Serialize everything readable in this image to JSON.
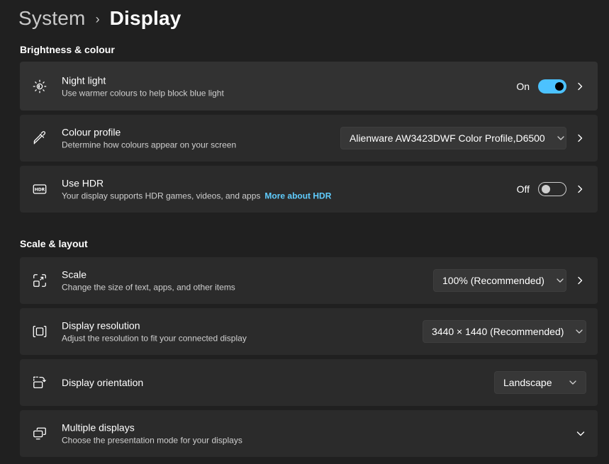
{
  "breadcrumb": {
    "parent": "System",
    "separator": "›",
    "current": "Display"
  },
  "sections": {
    "brightness": {
      "title": "Brightness & colour"
    },
    "scale_layout": {
      "title": "Scale & layout"
    }
  },
  "night_light": {
    "title": "Night light",
    "description": "Use warmer colours to help block blue light",
    "state_label": "On",
    "enabled": true,
    "icon": "brightness-icon"
  },
  "colour_profile": {
    "title": "Colour profile",
    "description": "Determine how colours appear on your screen",
    "selected": "Alienware AW3423DWF Color Profile,D6500",
    "icon": "eyedropper-icon"
  },
  "hdr": {
    "title": "Use HDR",
    "description": "Your display supports HDR games, videos, and apps",
    "link": "More about HDR",
    "state_label": "Off",
    "enabled": false,
    "icon": "hdr-icon"
  },
  "scale": {
    "title": "Scale",
    "description": "Change the size of text, apps, and other items",
    "selected": "100% (Recommended)",
    "icon": "scale-icon"
  },
  "resolution": {
    "title": "Display resolution",
    "description": "Adjust the resolution to fit your connected display",
    "selected": "3440 × 1440 (Recommended)",
    "icon": "resolution-icon"
  },
  "orientation": {
    "title": "Display orientation",
    "selected": "Landscape",
    "icon": "orientation-icon"
  },
  "multiple_displays": {
    "title": "Multiple displays",
    "description": "Choose the presentation mode for your displays",
    "icon": "multiple-displays-icon"
  },
  "colors": {
    "accent": "#4cc2ff",
    "link": "#60cdff",
    "background": "#202020",
    "card": "#2b2b2b"
  }
}
